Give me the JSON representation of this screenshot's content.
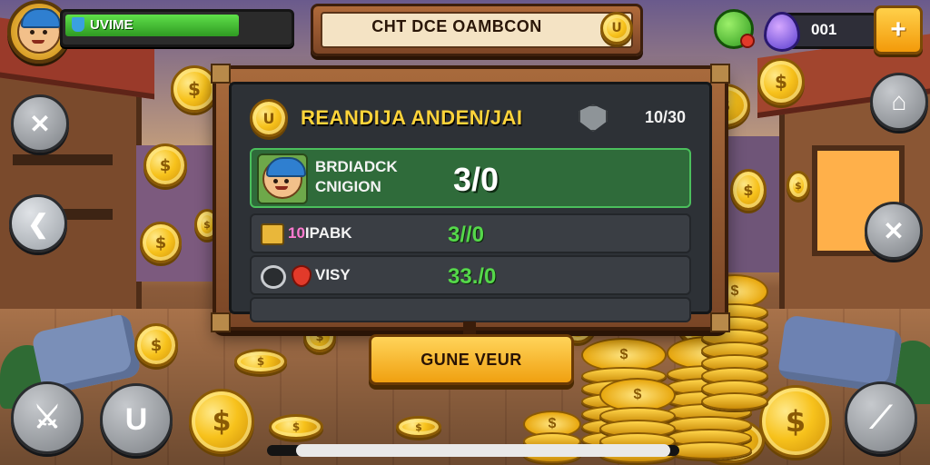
{
  "hud": {
    "health_label": "UVIME",
    "health_fill_pct": 78,
    "title": "CHT DCE OAMBCON",
    "title_coin_glyph": "U",
    "gems": "001",
    "plus_glyph": "+"
  },
  "board": {
    "coin_glyph": "U",
    "title": "REANDIJA ANDEN/JAI",
    "count": "10/30",
    "rows": [
      {
        "name_line1": "BRDIADCK",
        "name_line2": "CNIGION",
        "score": "3/0",
        "highlighted": true
      },
      {
        "label_prefix": "10",
        "label_text": "IPABK",
        "score": "3//0"
      },
      {
        "label_text": "VISY",
        "score": "33./0"
      }
    ]
  },
  "primary_button": "GUNE VEUR",
  "coin_glyph": "$",
  "colors": {
    "accent_yellow": "#ffd43a",
    "highlight_green": "#2f6b3a",
    "score_green": "#55d84a"
  }
}
